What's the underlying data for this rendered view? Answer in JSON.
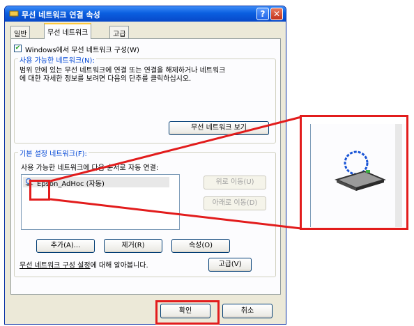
{
  "window": {
    "title": "무선 네트워크 연결 속성",
    "help_label": "?",
    "close_label": "✕",
    "title_icon": "network-connection-icon"
  },
  "tabs": [
    {
      "label": "일반"
    },
    {
      "label": "무선 네트워크",
      "selected": true
    },
    {
      "label": "고급"
    }
  ],
  "use_windows": {
    "label": "Windows에서 무선 네트워크 구성(W)",
    "checked": true
  },
  "available": {
    "legend": "사용 가능한 네트워크(N):",
    "description": "범위 안에 있는 무선 네트워크에 연결 또는 연결을 해제하거나 네트워크에 대한 자세한 정보를 보려면 다음의 단추를 클릭하십시오.",
    "view_button": "무선 네트워크 보기"
  },
  "preferred": {
    "legend": "기본 설정 네트워크(F):",
    "auto_connect_label": "사용 가능한 네트워크에 다음 순서로 자동 연결:",
    "networks": [
      {
        "name": "Epson_AdHoc (자동)",
        "icon": "wireless-network-icon"
      }
    ],
    "move_up": "위로 이동(U)",
    "move_down": "아래로 이동(D)",
    "add": "추가(A)...",
    "remove": "제거(R)",
    "properties": "속성(O)"
  },
  "learn_more": {
    "link": "무선 네트워크 구성 설정",
    "text": "에 대해 알아봅니다.",
    "advanced": "고급(V)"
  },
  "footer": {
    "ok": "확인",
    "cancel": "취소"
  },
  "highlight_color": "#e21c1c"
}
